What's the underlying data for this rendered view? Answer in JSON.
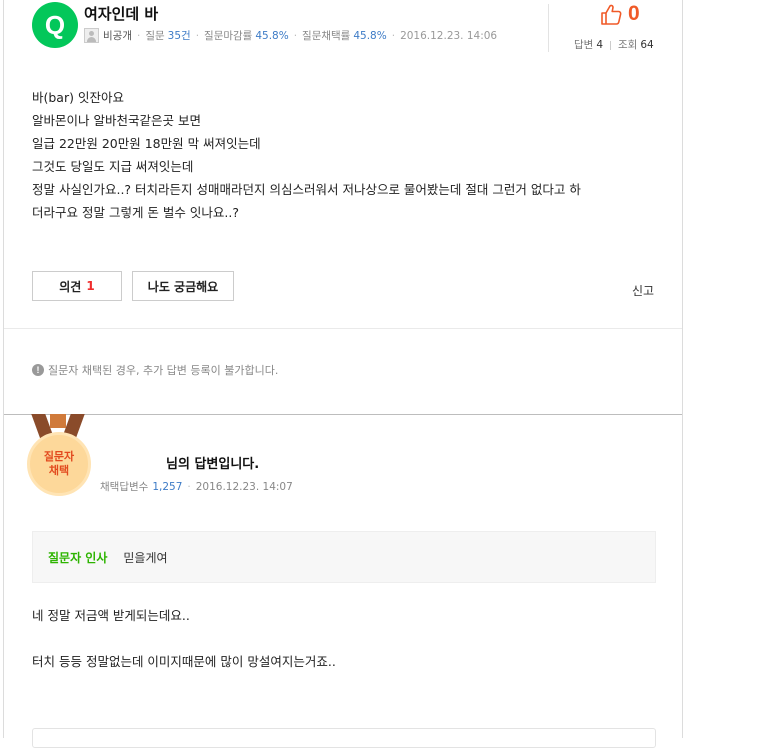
{
  "question": {
    "badge": "Q",
    "title": "여자인데 바",
    "author": "비공개",
    "meta": [
      {
        "label": "질문",
        "value": "35건"
      },
      {
        "label": "질문마감률",
        "value": "45.8%"
      },
      {
        "label": "질문채택률",
        "value": "45.8%"
      }
    ],
    "date": "2016.12.23. 14:06",
    "like_count": "0",
    "answers_label": "답변",
    "answers_count": "4",
    "views_label": "조회",
    "views_count": "64",
    "body": [
      "바(bar) 잇잔아요",
      "알바몬이나 알바천국같은곳 보면",
      "일급 22만원 20만원 18만원 막 써져잇는데",
      "그것도 당일도 지급 써져잇는데",
      "정말 사실인가요..? 터치라든지 성매매라던지 의심스러워서 저나상으로 물어봤는데 절대 그런거 없다고 하",
      "더라구요 정말 그렇게 돈 벌수 잇나요..?"
    ],
    "opinion_label": "의견",
    "opinion_count": "1",
    "curious_label": "나도 궁금해요",
    "report_label": "신고",
    "notice": "질문자 채택된 경우, 추가 답변 등록이 불가합니다."
  },
  "answer": {
    "medal_line1": "질문자",
    "medal_line2": "채택",
    "title": "님의 답변입니다.",
    "meta_label": "채택답변수",
    "meta_value": "1,257",
    "date": "2016.12.23. 14:07",
    "greeting_label": "질문자 인사",
    "greeting_text": "믿을게여",
    "body": [
      "네 정말 저금액 받게되는데요..",
      "",
      "터치 등등 정말없는데 이미지때문에 많이 망설여지는거죠.."
    ]
  },
  "colors": {
    "brand_green": "#03c75a",
    "like_orange": "#f05a28",
    "link_blue": "#3d7bc6",
    "greeting_green": "#2db400"
  }
}
